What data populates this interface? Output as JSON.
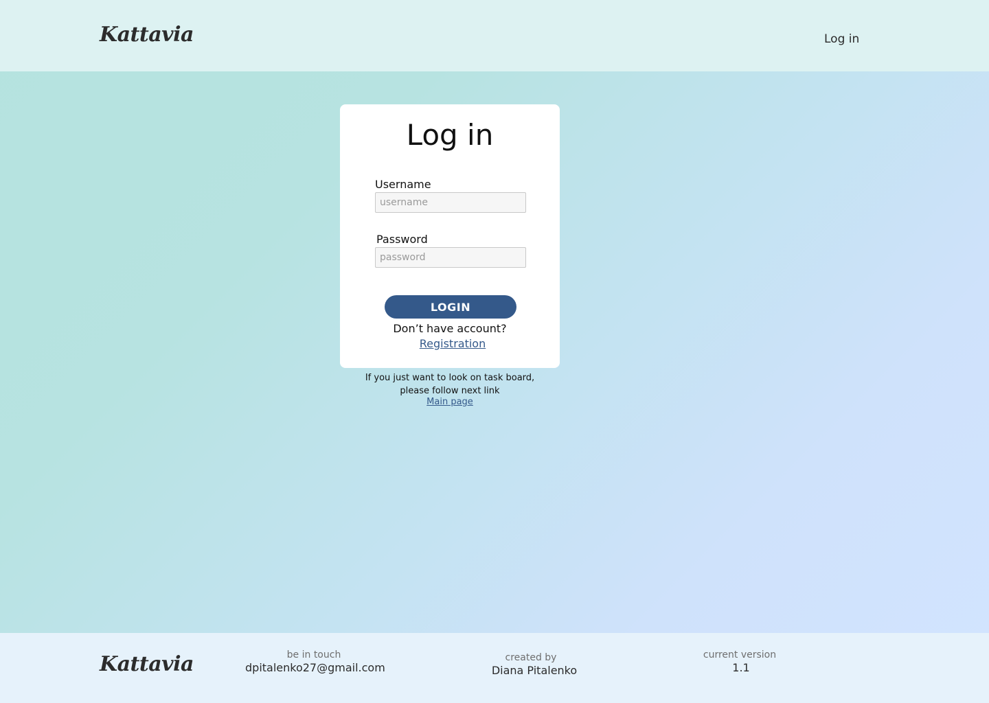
{
  "header": {
    "logo": "Kattavia",
    "nav_login": "Log in"
  },
  "card": {
    "title": "Log in",
    "username_label": "Username",
    "username_placeholder": "username",
    "password_label": "Password",
    "password_placeholder": "password",
    "login_button": "LOGIN",
    "no_account": "Don’t have account?",
    "registration_link": "Registration"
  },
  "hint": {
    "line1": "If you just want to look on task board,",
    "line2": "please follow next link",
    "main_link": "Main page"
  },
  "footer": {
    "logo": "Kattavia",
    "contact_label": "be in touch",
    "contact_email": "dpitalenko27@gmail.com",
    "author_label": "created by",
    "author_name": "Diana Pitalenko",
    "version_label": "current version",
    "version_value": "1.1"
  }
}
